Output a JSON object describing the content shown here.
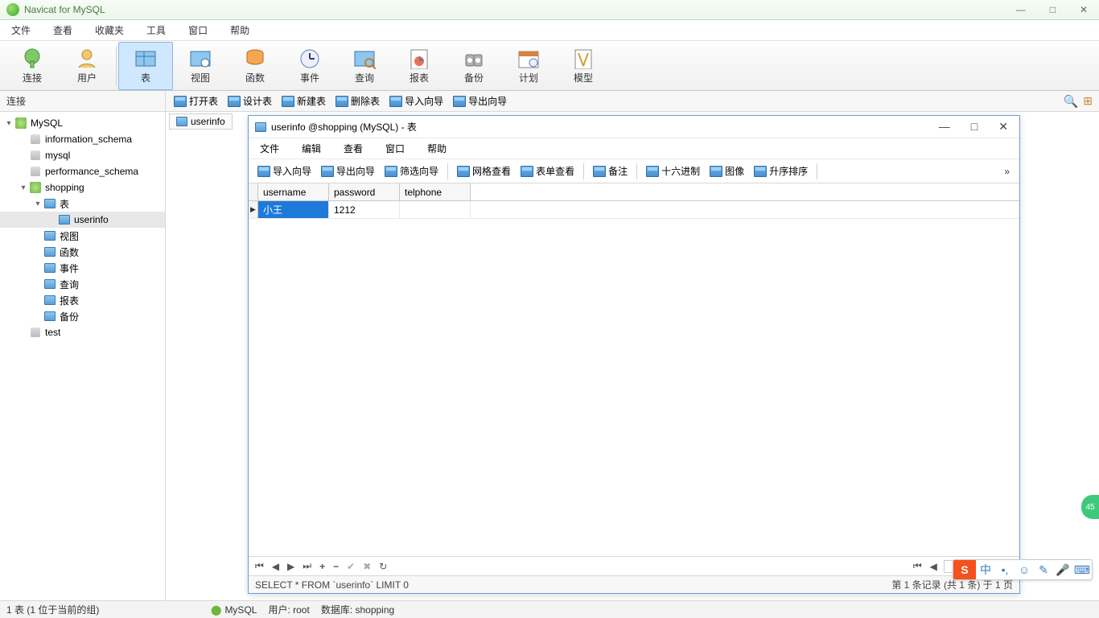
{
  "window": {
    "title": "Navicat for MySQL"
  },
  "mainmenu": [
    "文件",
    "查看",
    "收藏夹",
    "工具",
    "窗口",
    "帮助"
  ],
  "toolbar": [
    {
      "label": "连接",
      "icon": "plug"
    },
    {
      "label": "用户",
      "icon": "user"
    },
    {
      "label": "表",
      "icon": "table",
      "active": true
    },
    {
      "label": "视图",
      "icon": "view"
    },
    {
      "label": "函数",
      "icon": "func"
    },
    {
      "label": "事件",
      "icon": "event"
    },
    {
      "label": "查询",
      "icon": "query"
    },
    {
      "label": "报表",
      "icon": "report"
    },
    {
      "label": "备份",
      "icon": "backup"
    },
    {
      "label": "计划",
      "icon": "schedule"
    },
    {
      "label": "模型",
      "icon": "model"
    }
  ],
  "subbar_left": "连接",
  "subbar_buttons": [
    "打开表",
    "设计表",
    "新建表",
    "删除表",
    "导入向导",
    "导出向导"
  ],
  "tree": {
    "root": "MySQL",
    "dbs": [
      {
        "name": "information_schema"
      },
      {
        "name": "mysql"
      },
      {
        "name": "performance_schema"
      },
      {
        "name": "shopping",
        "open": true,
        "children": [
          {
            "name": "表",
            "open": true,
            "items": [
              "userinfo"
            ],
            "sel": "userinfo"
          },
          {
            "name": "视图"
          },
          {
            "name": "函数"
          },
          {
            "name": "事件"
          },
          {
            "name": "查询"
          },
          {
            "name": "报表"
          },
          {
            "name": "备份"
          }
        ]
      },
      {
        "name": "test"
      }
    ]
  },
  "tab": "userinfo",
  "subwin": {
    "title": "userinfo @shopping (MySQL) - 表",
    "menu": [
      "文件",
      "编辑",
      "查看",
      "窗口",
      "帮助"
    ],
    "tools": [
      "导入向导",
      "导出向导",
      "筛选向导",
      "网格查看",
      "表单查看",
      "备注",
      "十六进制",
      "图像",
      "升序排序"
    ],
    "columns": [
      "username",
      "password",
      "telphone"
    ],
    "rows": [
      [
        "小王",
        "1212",
        ""
      ]
    ],
    "nav_page": "1",
    "status_left": "SELECT * FROM `userinfo` LIMIT 0",
    "status_right": "第 1 条记录 (共 1 条) 于 1 页"
  },
  "statusbar": {
    "left": "1 表 (1 位于当前的组)",
    "conn": "MySQL",
    "user": "用户: root",
    "db": "数据库: shopping"
  },
  "badge": "45",
  "ime": {
    "chars": [
      "中",
      "•,",
      "☺",
      "✎",
      "🎤",
      "⌨"
    ]
  }
}
